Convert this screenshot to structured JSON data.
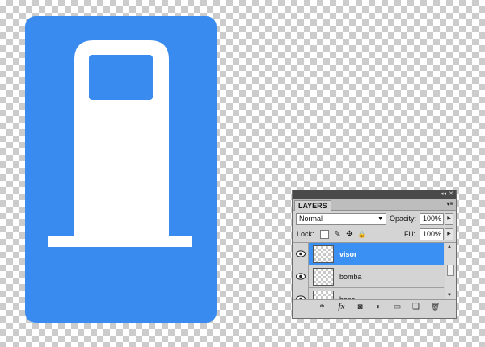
{
  "artwork": {
    "sign_color": "#3a8bef",
    "pump_color": "#ffffff"
  },
  "layers_panel": {
    "collapse_glyph": "◂◂",
    "close_glyph": "✕",
    "tab_label": "LAYERS",
    "menu_glyph": "▾≡",
    "blend_mode": "Normal",
    "blend_caret": "▼",
    "opacity_label": "Opacity:",
    "opacity_value": "100%",
    "lock_label": "Lock:",
    "fill_label": "Fill:",
    "fill_value": "100%",
    "slider_glyph": "▶",
    "lock_icons": {
      "paint": "✎",
      "move": "✥",
      "all": "🔒"
    },
    "layers": [
      {
        "name": "visor",
        "selected": true
      },
      {
        "name": "bomba",
        "selected": false
      },
      {
        "name": "base",
        "selected": false
      }
    ],
    "scroll_glyphs": {
      "up": "▲",
      "down": "▼"
    },
    "bottom_icons": {
      "link": "⚭",
      "fx": "fx",
      "mask": "◙",
      "adjust": "◐",
      "group": "▭",
      "new_layer": "❏",
      "delete": "🗑"
    },
    "selection_color": "#3a91f3"
  }
}
